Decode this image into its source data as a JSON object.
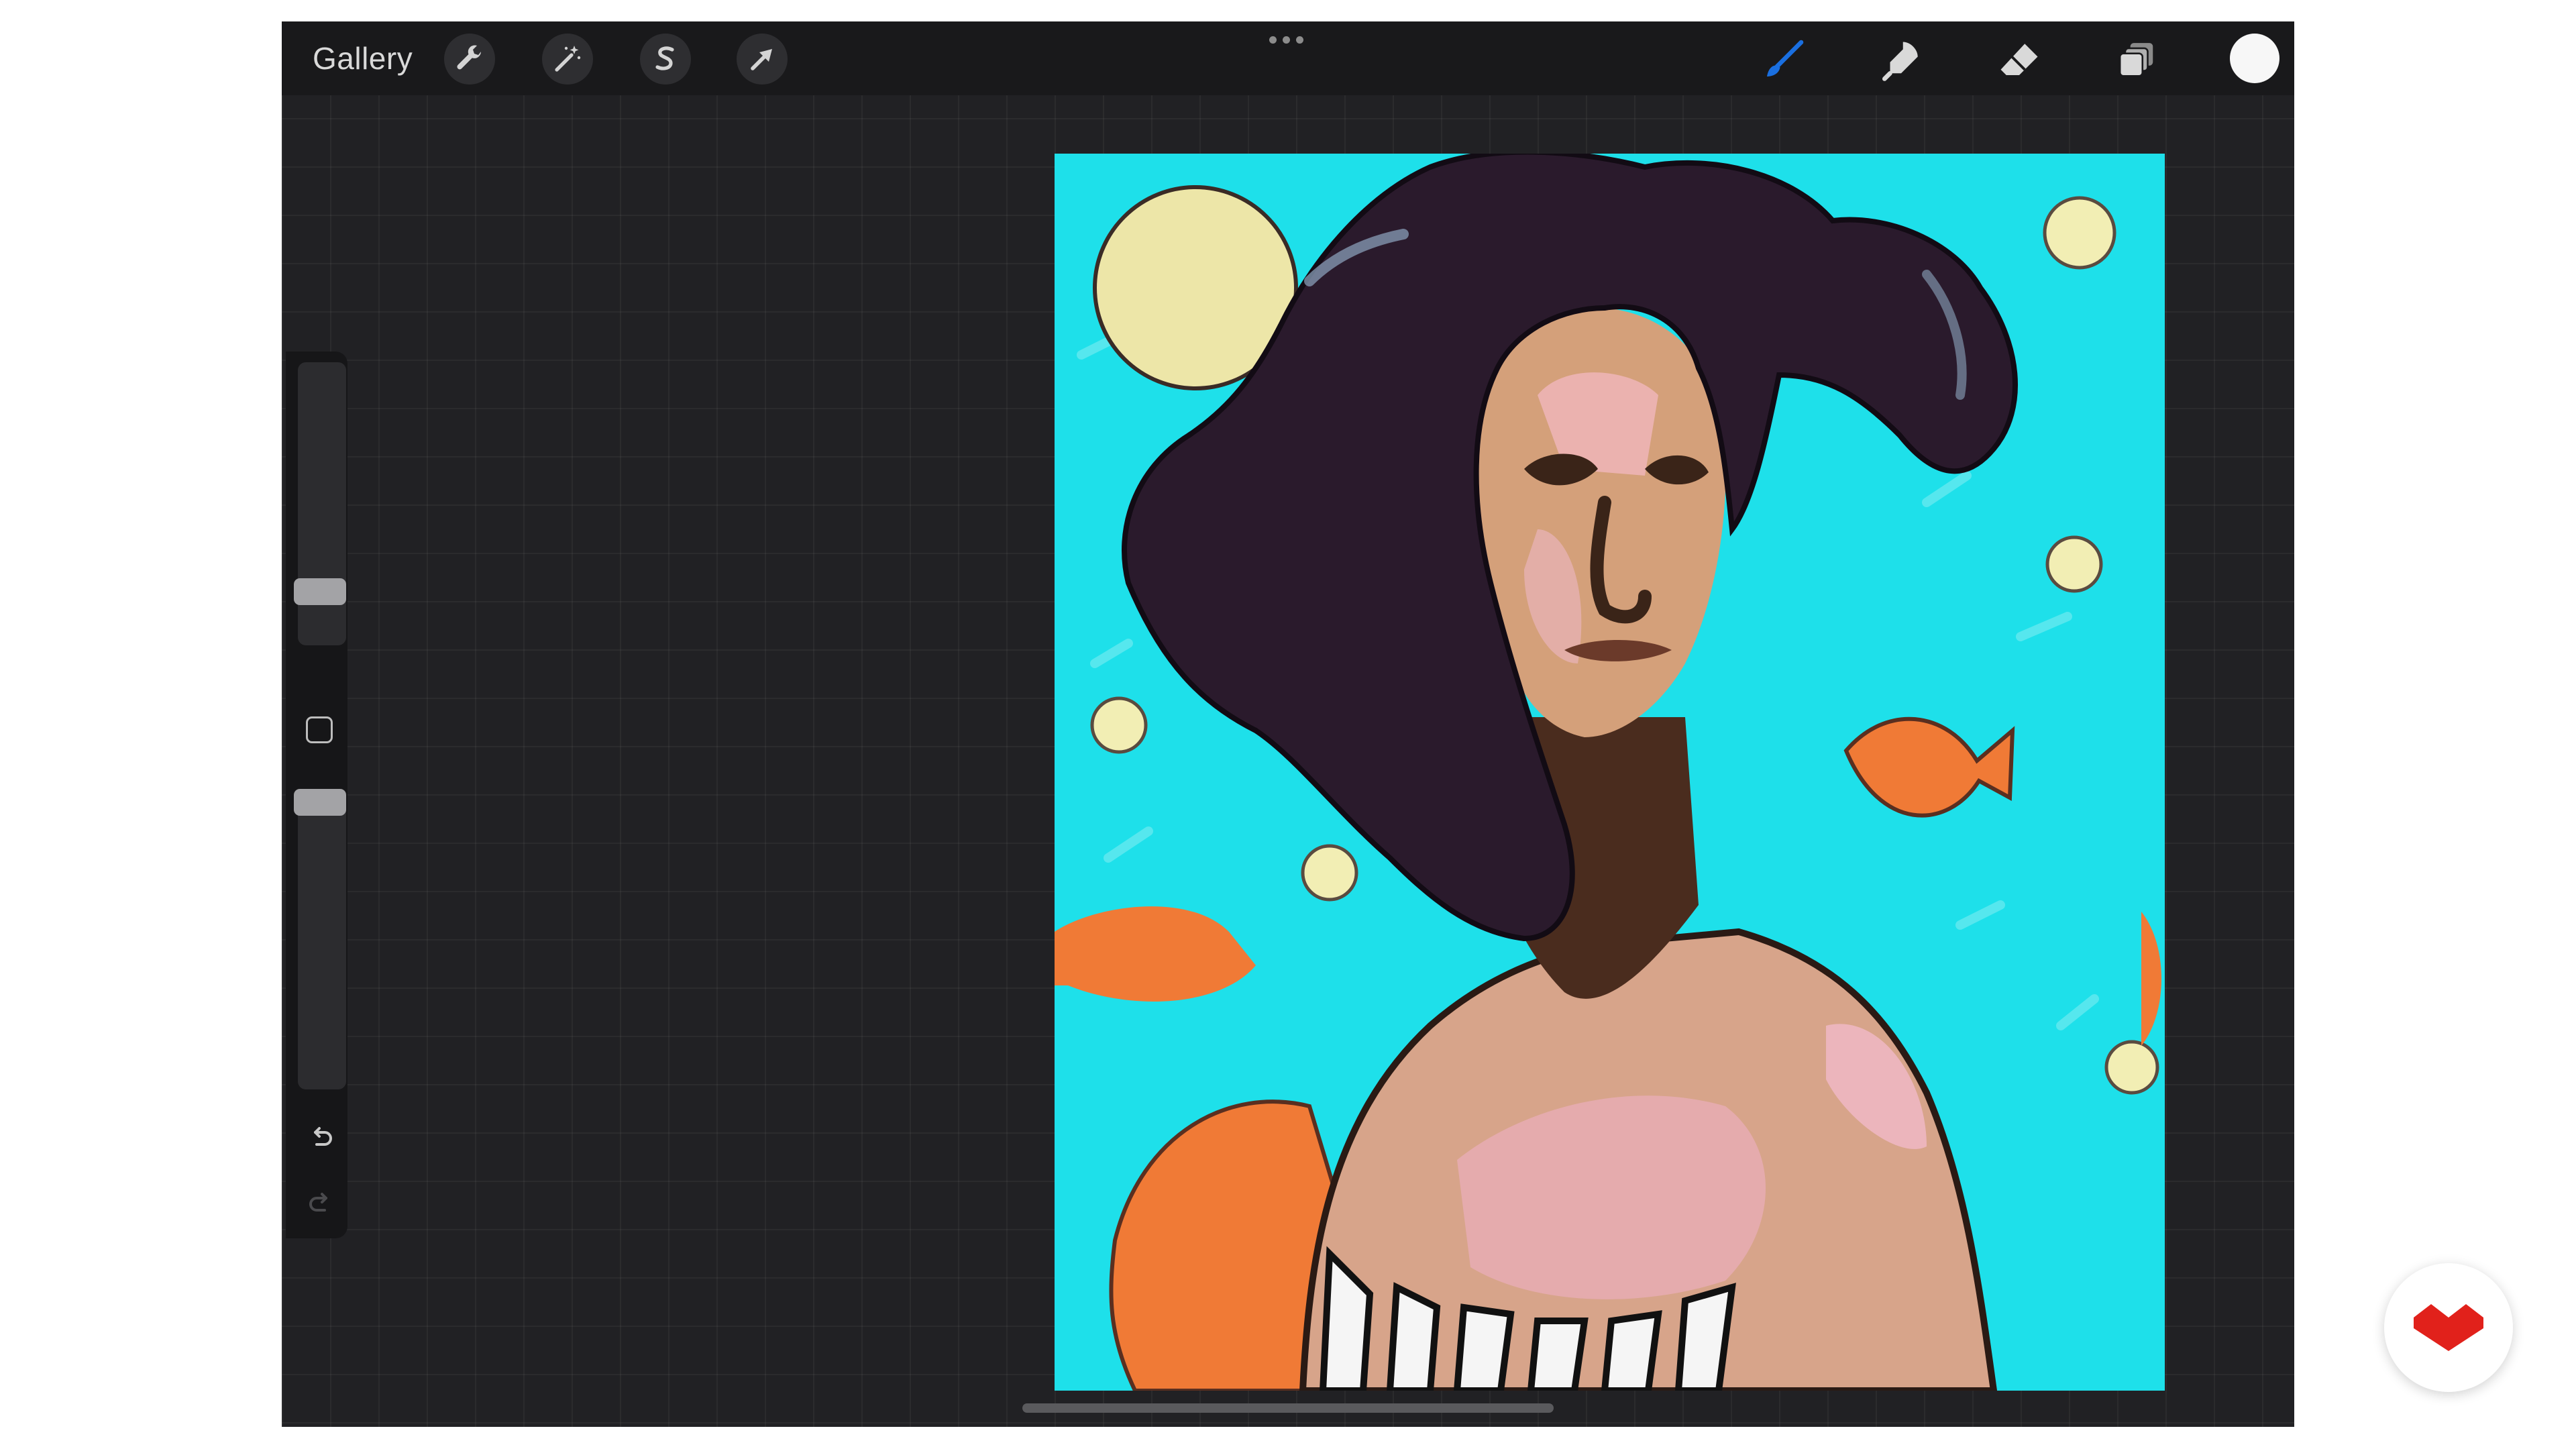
{
  "toolbar": {
    "gallery_label": "Gallery",
    "left_tools": [
      "wrench-icon",
      "magic-wand-icon",
      "selection-s-icon",
      "transform-arrow-icon"
    ],
    "right_tools": [
      "brush-icon",
      "smudge-icon",
      "eraser-icon",
      "layers-icon"
    ],
    "active_tool": "brush-icon",
    "current_color": "#f7f7f7"
  },
  "sidebar": {
    "brush_size_level": 0.18,
    "opacity_level": 0.95,
    "icons": [
      "modifier-square-icon",
      "undo-icon",
      "redo-icon"
    ]
  },
  "colors": {
    "accent": "#1a6fe0",
    "canvas_background": "#1ee0ea",
    "logo_red": "#e1211b"
  }
}
